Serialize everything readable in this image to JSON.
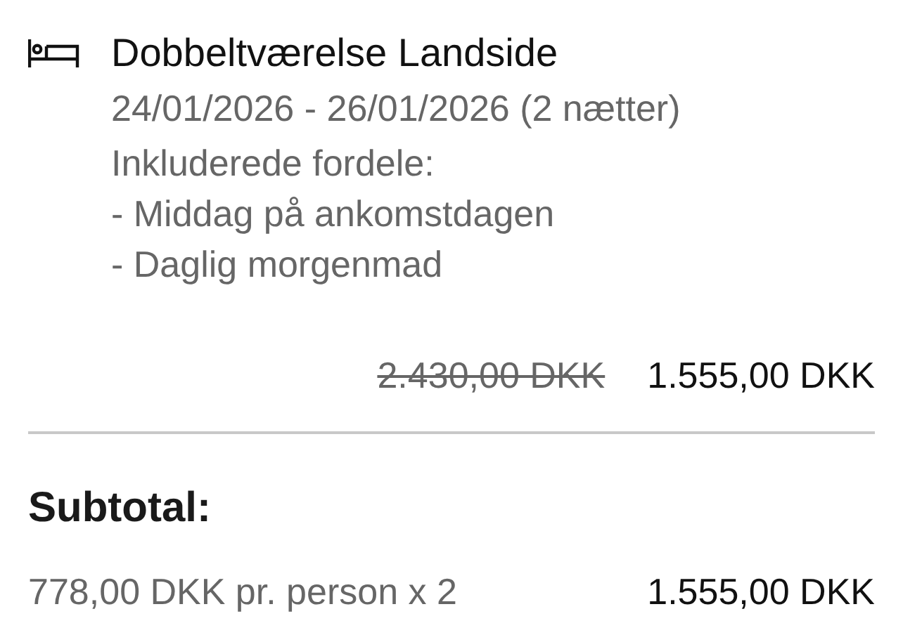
{
  "room": {
    "name": "Dobbeltværelse Landside",
    "dates": "24/01/2026 - 26/01/2026 (2 nætter)",
    "benefits_title": "Inkluderede fordele:",
    "benefits": [
      "- Middag på ankomstdagen",
      "- Daglig morgenmad"
    ]
  },
  "price": {
    "original": "2.430,00 DKK",
    "current": "1.555,00 DKK"
  },
  "subtotal": {
    "label": "Subtotal:",
    "detail": "778,00 DKK pr. person x 2",
    "amount": "1.555,00 DKK"
  }
}
